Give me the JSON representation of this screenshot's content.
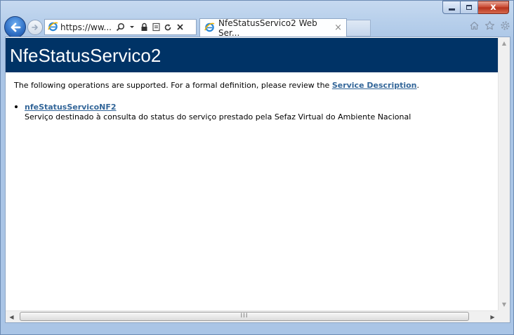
{
  "browser": {
    "address_url": "https://ww...",
    "tab_title": "NfeStatusServico2 Web Ser...",
    "tab_close": "×",
    "caption_close": "x"
  },
  "page": {
    "title": "NfeStatusServico2",
    "intro_text": "The following operations are supported. For a formal definition, please review the ",
    "intro_link": "Service Description",
    "intro_end": ".",
    "operations": [
      {
        "name": "nfeStatusServicoNF2",
        "description": "Serviço destinado à consulta do status do serviço prestado pela Sefaz Virtual do Ambiente Nacional"
      }
    ]
  },
  "scrollbar": {
    "grip": "III"
  },
  "colors": {
    "banner": "#003366",
    "link": "#336699"
  },
  "icons": [
    "back-arrow-icon",
    "forward-arrow-icon",
    "ie-logo-icon",
    "search-icon",
    "dropdown-icon",
    "lock-icon",
    "compatibility-icon",
    "refresh-icon",
    "stop-icon",
    "home-icon",
    "favorites-star-icon",
    "gear-icon"
  ]
}
